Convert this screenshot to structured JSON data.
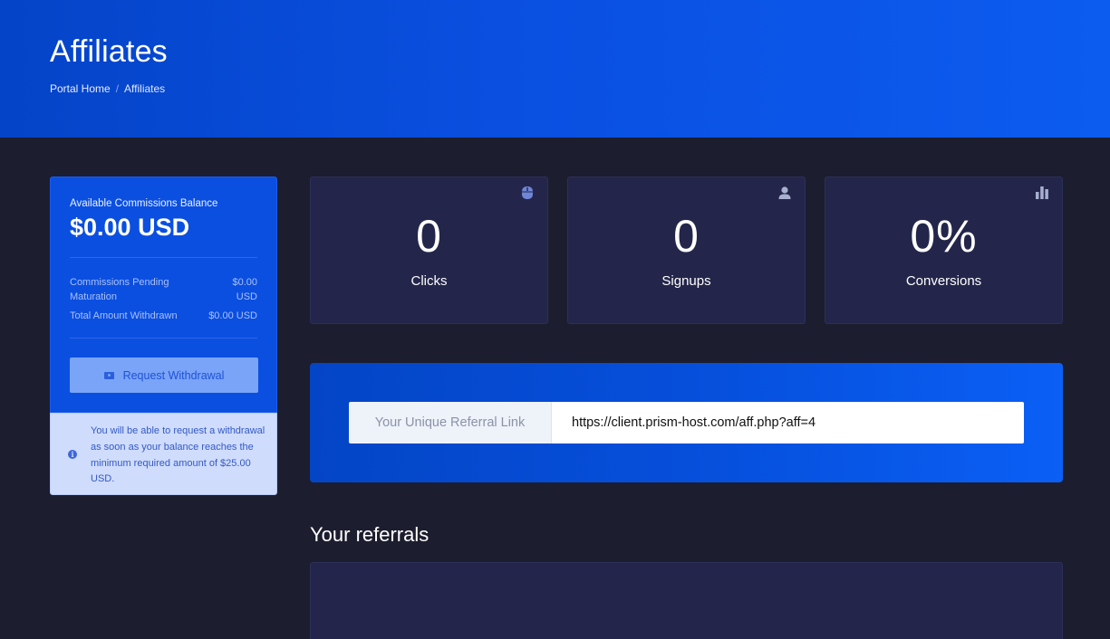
{
  "header": {
    "title": "Affiliates",
    "breadcrumb": [
      {
        "label": "Portal Home"
      },
      {
        "label": "Affiliates"
      }
    ]
  },
  "balance": {
    "label": "Available Commissions Balance",
    "amount": "$0.00 USD",
    "pending_label": "Commissions Pending Maturation",
    "pending_value": "$0.00 USD",
    "withdrawn_label": "Total Amount Withdrawn",
    "withdrawn_value": "$0.00 USD",
    "withdraw_button": "Request Withdrawal",
    "notice": "You will be able to request a withdrawal as soon as your balance reaches the minimum required amount of $25.00 USD."
  },
  "stats": [
    {
      "value": "0",
      "label": "Clicks",
      "icon": "mouse-icon"
    },
    {
      "value": "0",
      "label": "Signups",
      "icon": "user-icon"
    },
    {
      "value": "0%",
      "label": "Conversions",
      "icon": "bar-chart-icon"
    }
  ],
  "referral": {
    "addon_label": "Your Unique Referral Link",
    "link": "https://client.prism-host.com/aff.php?aff=4"
  },
  "referrals_section": {
    "title": "Your referrals"
  },
  "colors": {
    "background": "#1c1d2e",
    "brand_blue": "#0b4fe0",
    "card": "#23264a",
    "notice_bg": "#cfdcfb"
  }
}
